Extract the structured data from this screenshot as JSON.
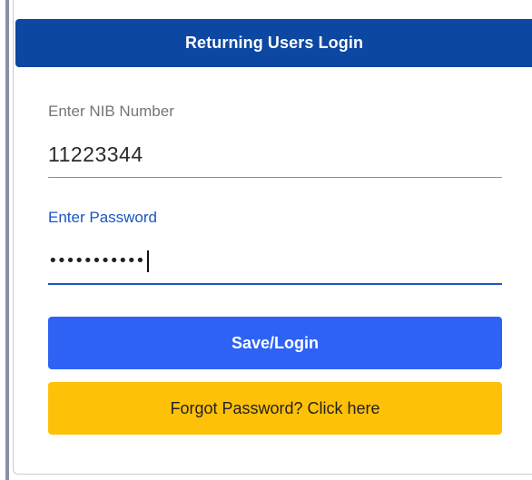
{
  "card": {
    "title": "Returning Users Login"
  },
  "nib_field": {
    "label": "Enter NIB Number",
    "value": "11223344"
  },
  "password_field": {
    "label": "Enter Password",
    "masked_value": "•••••••••••",
    "focused": true
  },
  "buttons": {
    "login_label": "Save/Login",
    "forgot_label": "Forgot Password? Click here"
  },
  "colors": {
    "header_bg": "#0c47a1",
    "focus_accent": "#1a56c4",
    "login_button": "#2d62f5",
    "forgot_button": "#ffc107"
  }
}
